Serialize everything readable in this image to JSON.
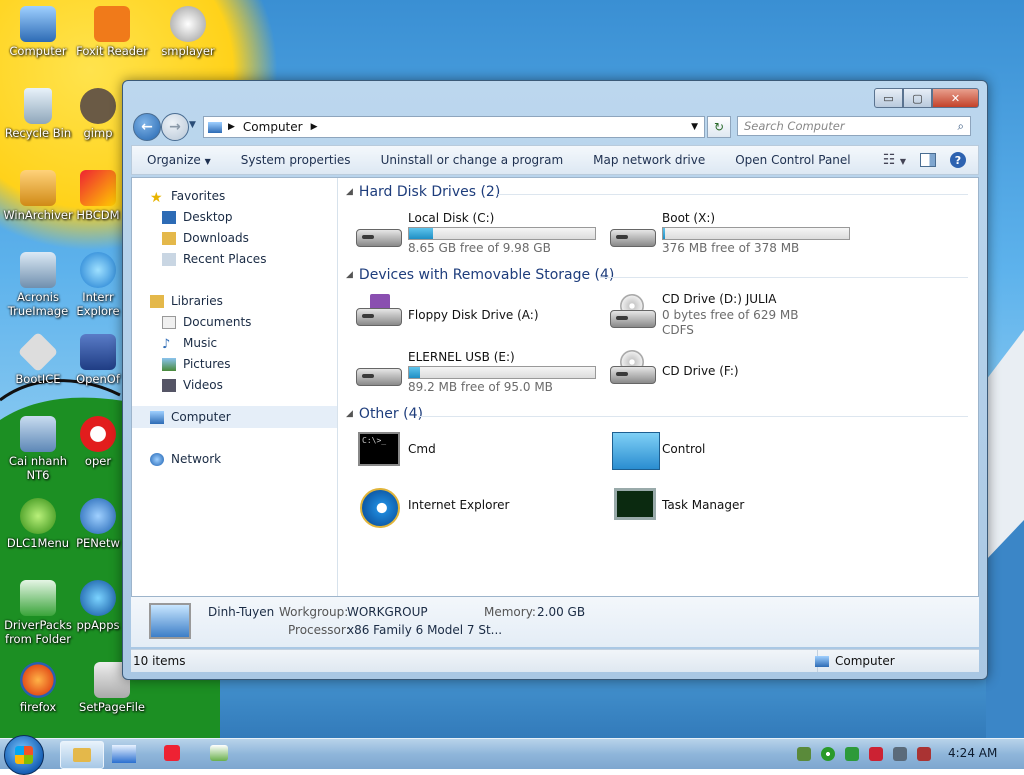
{
  "desktop": {
    "icons": [
      {
        "label": "Computer"
      },
      {
        "label": "Foxit Reader"
      },
      {
        "label": "smplayer"
      },
      {
        "label": "Recycle Bin"
      },
      {
        "label": "gimp"
      },
      {
        "label": "WinArchiver"
      },
      {
        "label": "HBCDM"
      },
      {
        "label": "Acronis TrueImage"
      },
      {
        "label": "Interr Explore"
      },
      {
        "label": "BootICE"
      },
      {
        "label": "OpenOf"
      },
      {
        "label": "Cai nhanh NT6"
      },
      {
        "label": "oper"
      },
      {
        "label": "DLC1Menu"
      },
      {
        "label": "PENetw"
      },
      {
        "label": "DriverPacks from Folder"
      },
      {
        "label": "ppApps"
      },
      {
        "label": "firefox"
      },
      {
        "label": "SetPageFile"
      }
    ]
  },
  "window": {
    "caption": {
      "min": "▭",
      "max": "▢",
      "close": "✕"
    },
    "address": {
      "path": "Computer"
    },
    "search": {
      "placeholder": "Search Computer"
    },
    "toolbar": {
      "organize": "Organize",
      "system_properties": "System properties",
      "uninstall": "Uninstall or change a program",
      "map_drive": "Map network drive",
      "control_panel": "Open Control Panel"
    },
    "nav": {
      "favorites": "Favorites",
      "desktop": "Desktop",
      "downloads": "Downloads",
      "recent": "Recent Places",
      "libraries": "Libraries",
      "documents": "Documents",
      "music": "Music",
      "pictures": "Pictures",
      "videos": "Videos",
      "computer": "Computer",
      "network": "Network"
    },
    "groups": {
      "hdd": "Hard Disk Drives (2)",
      "removable": "Devices with Removable Storage (4)",
      "other": "Other (4)"
    },
    "drives": {
      "c": {
        "name": "Local Disk (C:)",
        "info": "8.65 GB free of 9.98 GB",
        "used_fraction": 0.13
      },
      "x": {
        "name": "Boot (X:)",
        "info": "376 MB free of 378 MB",
        "used_fraction": 0.01
      },
      "a": {
        "name": "Floppy Disk Drive (A:)"
      },
      "d": {
        "name": "CD Drive (D:) JULIA",
        "info": "0 bytes free of 629 MB",
        "fs": "CDFS"
      },
      "e": {
        "name": "ELERNEL USB (E:)",
        "info": "89.2 MB free of 95.0 MB",
        "used_fraction": 0.06
      },
      "f": {
        "name": "CD Drive (F:)"
      }
    },
    "other": {
      "cmd": "Cmd",
      "control": "Control",
      "ie": "Internet Explorer",
      "taskmgr": "Task Manager",
      "cmd_prompt": "C:\\>_"
    },
    "details": {
      "name": "Dinh-Tuyen",
      "workgroup_label": "Workgroup:",
      "workgroup": "WORKGROUP",
      "memory_label": "Memory:",
      "memory": "2.00 GB",
      "processor_label": "Processor:",
      "processor": "x86 Family 6 Model 7 St..."
    },
    "status": {
      "items": "10 items",
      "location": "Computer"
    }
  },
  "taskbar": {
    "clock": "4:24 AM"
  }
}
